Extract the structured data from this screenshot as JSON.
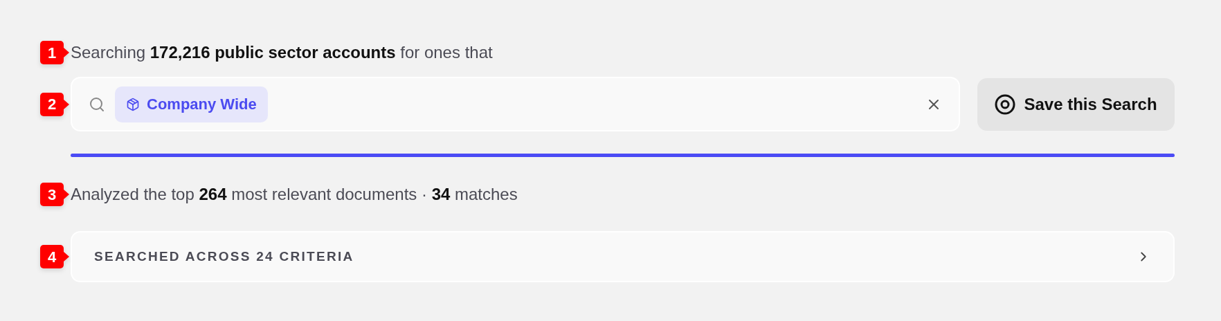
{
  "header": {
    "marker": "1",
    "text": "Searching **172,216 public sector accounts** for ones that"
  },
  "search": {
    "marker": "2",
    "chips": [
      {
        "label": "Company Wide"
      }
    ]
  },
  "save_button": {
    "label": "Save this Search"
  },
  "progress": {
    "level": 1
  },
  "summary": {
    "marker": "3",
    "text": "Analyzed the top **264** most relevant documents · **34** matches"
  },
  "criteria": {
    "marker": "4",
    "label": "SEARCHED ACROSS 24 CRITERIA"
  }
}
